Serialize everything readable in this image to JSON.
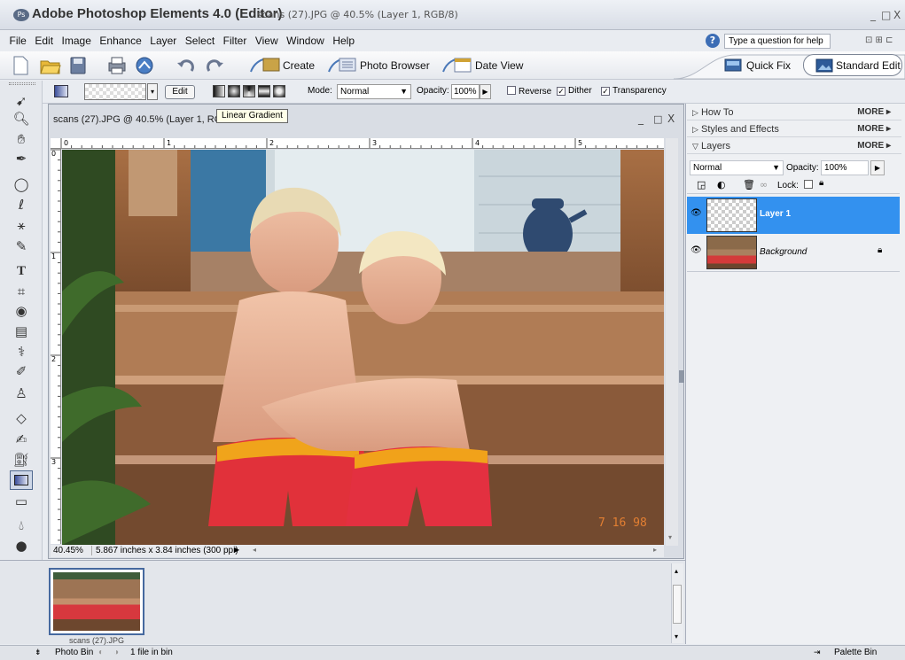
{
  "app": {
    "title": "Adobe Photoshop Elements 4.0 (Editor)",
    "doc_title": "scans (27).JPG @ 40.5% (Layer 1, RGB/8)",
    "window_controls": [
      "_",
      "□",
      "X"
    ]
  },
  "menu": [
    "File",
    "Edit",
    "Image",
    "Enhance",
    "Layer",
    "Select",
    "Filter",
    "View",
    "Window",
    "Help"
  ],
  "help": {
    "placeholder": "Type a question for help"
  },
  "shortcuts": {
    "create": "Create",
    "photo_browser": "Photo Browser",
    "date_view": "Date View",
    "quick_fix": "Quick Fix",
    "standard_edit": "Standard Edit"
  },
  "options": {
    "edit_label": "Edit",
    "mode_label": "Mode:",
    "mode_value": "Normal",
    "opacity_label": "Opacity:",
    "opacity_value": "100%",
    "reverse": "Reverse",
    "dither": "Dither",
    "transparency": "Transparency",
    "reverse_checked": false,
    "dither_checked": true,
    "transparency_checked": true
  },
  "document": {
    "tab_title": "scans (27).JPG @ 40.5% (Layer 1, RGB/",
    "tooltip": "Linear Gradient",
    "ruler_top": [
      "0",
      "1",
      "2",
      "3",
      "4",
      "5"
    ],
    "ruler_left": [
      "0",
      "1",
      "2",
      "3"
    ],
    "zoom": "40.45%",
    "info": "5.867 inches x 3.84 inches (300 ppi)",
    "date_stamp": "7 16 98"
  },
  "palettes": [
    {
      "label": "How To",
      "more": "MORE"
    },
    {
      "label": "Styles and Effects",
      "more": "MORE"
    },
    {
      "label": "Layers",
      "more": "MORE"
    }
  ],
  "layers_panel": {
    "blend_mode": "Normal",
    "opacity_label": "Opacity:",
    "opacity_value": "100%",
    "lock_label": "Lock:",
    "layers": [
      {
        "name": "Layer 1",
        "selected": true
      },
      {
        "name": "Background",
        "selected": false,
        "locked": true
      }
    ]
  },
  "photo_bin": {
    "thumbnail_caption": "scans (27).JPG",
    "label": "Photo Bin",
    "count": "1 file in bin",
    "palette_bin": "Palette Bin"
  }
}
